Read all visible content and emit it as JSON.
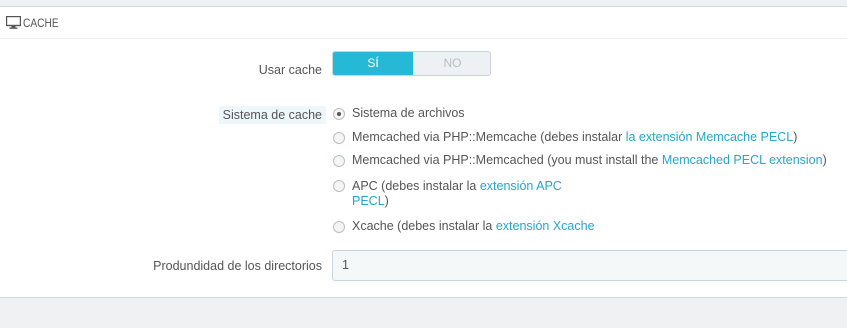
{
  "section": {
    "title": "CACHE",
    "icon": "monitor-icon"
  },
  "use_cache": {
    "label": "Usar cache",
    "yes": "SÍ",
    "no": "NO",
    "value": "yes"
  },
  "cache_system": {
    "label": "Sistema de cache",
    "selected": 0,
    "options": [
      {
        "text": "Sistema de archivos",
        "link": "",
        "suffix": ""
      },
      {
        "text": "Memcached via PHP::Memcache (debes instalar ",
        "link": "la extensión Memcache PECL",
        "suffix": ")"
      },
      {
        "text": "Memcached via PHP::Memcached (you must install the ",
        "link": "Memcached PECL extension",
        "suffix": ")"
      },
      {
        "text": "APC (debes instalar la ",
        "link": "extensión APC",
        "line2_link": "PECL",
        "suffix": ")"
      },
      {
        "text": "Xcache (debes instalar la ",
        "link": "extensión Xcache",
        "suffix": ""
      }
    ]
  },
  "depth": {
    "label": "Produndidad de los directorios",
    "value": "1"
  },
  "colors": {
    "accent": "#25b9d7",
    "link": "#25a6c9"
  }
}
